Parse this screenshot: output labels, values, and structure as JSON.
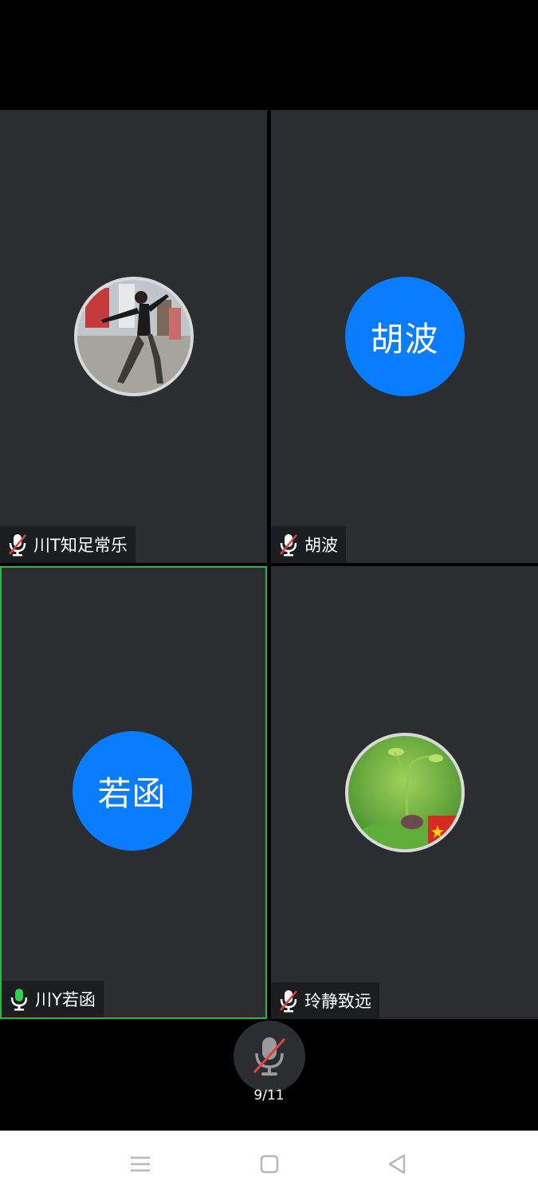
{
  "participants": [
    {
      "name": "川T知足常乐",
      "avatar_type": "photo",
      "avatar_icon": "person-photo",
      "mic": "muted"
    },
    {
      "name": "胡波",
      "avatar_type": "text",
      "avatar_text": "胡波",
      "avatar_color": "#0a7cff",
      "mic": "muted"
    },
    {
      "name": "川Y若函",
      "avatar_type": "text",
      "avatar_text": "若函",
      "avatar_color": "#0a7cff",
      "mic": "active",
      "speaking": true
    },
    {
      "name": "玲静致远",
      "avatar_type": "photo",
      "avatar_icon": "plant-photo",
      "mic": "muted"
    }
  ],
  "controls": {
    "mic_state": "muted",
    "page_indicator": "9/11"
  },
  "navbar": {
    "icons": [
      "menu-icon",
      "home-icon",
      "back-icon"
    ]
  },
  "colors": {
    "tile_bg": "#2b2d31",
    "avatar_blue": "#0a7cff",
    "speaking_border": "#2fb44a",
    "mute_red": "#e0413a",
    "mic_green": "#2fd24a"
  }
}
